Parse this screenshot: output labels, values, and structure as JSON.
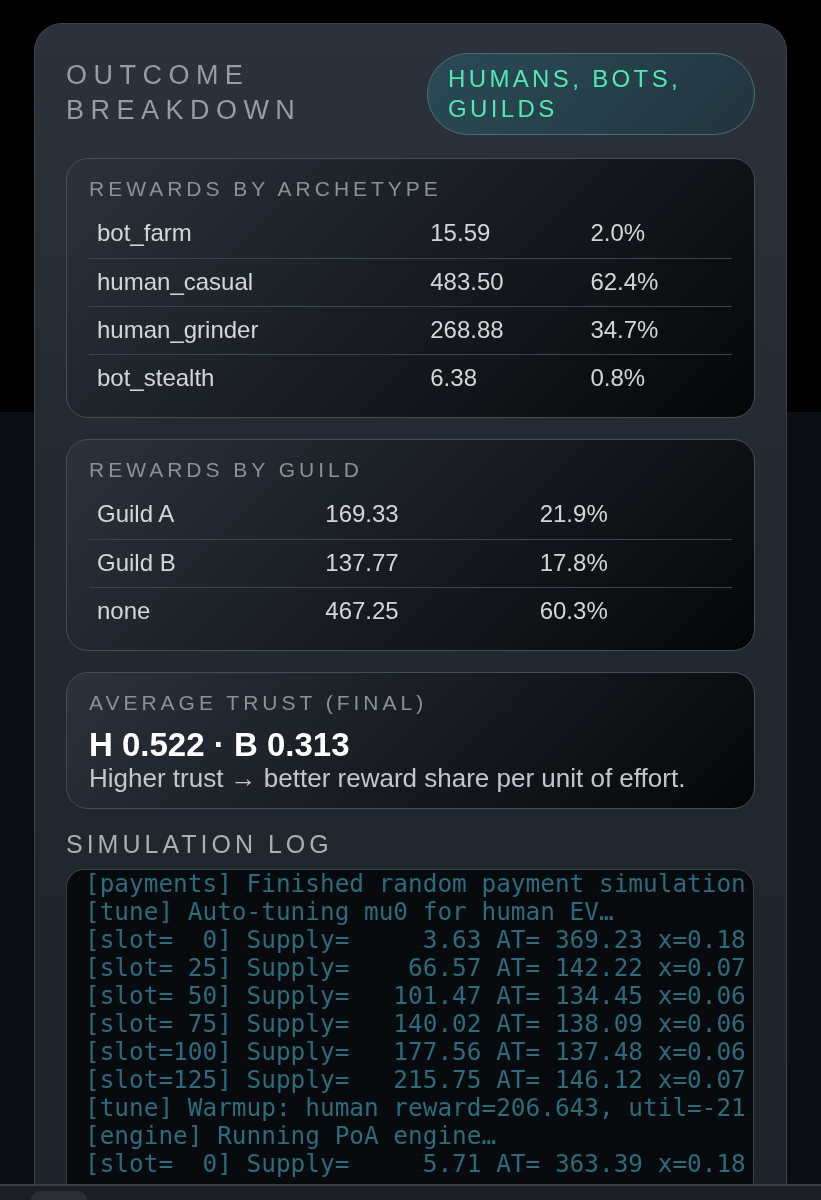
{
  "panel": {
    "title": "OUTCOME BREAKDOWN",
    "badge": "HUMANS, BOTS, GUILDS"
  },
  "rewards_by_archetype": {
    "title": "REWARDS BY ARCHETYPE",
    "rows": [
      {
        "name": "bot_farm",
        "reward": "15.59",
        "share": "2.0%"
      },
      {
        "name": "human_casual",
        "reward": "483.50",
        "share": "62.4%"
      },
      {
        "name": "human_grinder",
        "reward": "268.88",
        "share": "34.7%"
      },
      {
        "name": "bot_stealth",
        "reward": "6.38",
        "share": "0.8%"
      }
    ]
  },
  "rewards_by_guild": {
    "title": "REWARDS BY GUILD",
    "rows": [
      {
        "name": "Guild A",
        "reward": "169.33",
        "share": "21.9%"
      },
      {
        "name": "Guild B",
        "reward": "137.77",
        "share": "17.8%"
      },
      {
        "name": "none",
        "reward": "467.25",
        "share": "60.3%"
      }
    ]
  },
  "average_trust": {
    "title": "AVERAGE TRUST (FINAL)",
    "value": "H 0.522 · B 0.313",
    "note": "Higher trust → better reward share per unit of effort."
  },
  "simulation_log": {
    "title": "SIMULATION LOG",
    "lines": [
      "[payments] Finished random payment simulation",
      "[tune] Auto-tuning mu0 for human EV…",
      "[slot=  0] Supply=     3.63 AT= 369.23 x=0.18",
      "[slot= 25] Supply=    66.57 AT= 142.22 x=0.07",
      "[slot= 50] Supply=   101.47 AT= 134.45 x=0.06",
      "[slot= 75] Supply=   140.02 AT= 138.09 x=0.06",
      "[slot=100] Supply=   177.56 AT= 137.48 x=0.06",
      "[slot=125] Supply=   215.75 AT= 146.12 x=0.07",
      "[tune] Warmup: human reward=206.643, util=-21",
      "[engine] Running PoA engine…",
      "[slot=  0] Supply=     5.71 AT= 363.39 x=0.18"
    ]
  }
}
